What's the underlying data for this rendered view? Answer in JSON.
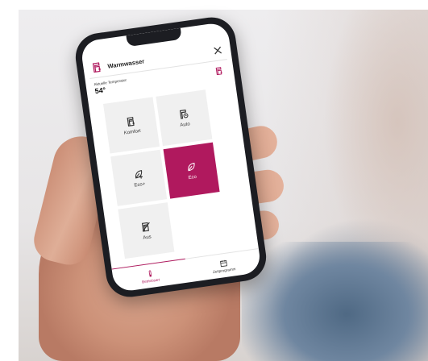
{
  "app": {
    "title": "Warmwasser",
    "title_icon": "water-heater-icon",
    "close_icon": "close-icon"
  },
  "temperature": {
    "label": "Aktuelle Temperatur",
    "value": "54°",
    "icon": "water-heater-icon"
  },
  "modes": [
    {
      "label": "Komfort",
      "icon": "water-heater-icon",
      "active": false
    },
    {
      "label": "Auto",
      "icon": "water-heater-clock-icon",
      "active": false
    },
    {
      "label": "Eco+",
      "icon": "leaf-plus-icon",
      "active": false
    },
    {
      "label": "Eco",
      "icon": "leaf-icon",
      "active": true
    },
    {
      "label": "Aus",
      "icon": "water-heater-off-icon",
      "active": false
    }
  ],
  "bottom_nav": [
    {
      "label": "Betriebsart",
      "icon": "thermometer-icon",
      "active": true
    },
    {
      "label": "Zeitprogramm",
      "icon": "calendar-icon",
      "active": false
    }
  ],
  "colors": {
    "accent": "#b0195e",
    "tile": "#f0f0f0"
  }
}
